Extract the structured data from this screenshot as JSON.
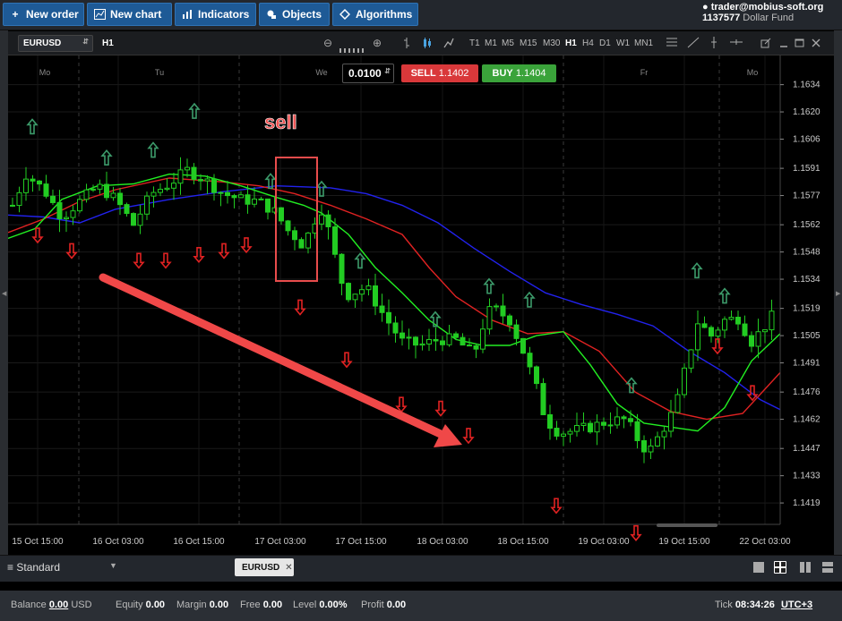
{
  "toolbar": {
    "new_order": "New order",
    "new_chart": "New chart",
    "indicators": "Indicators",
    "objects": "Objects",
    "algorithms": "Algorithms"
  },
  "account": {
    "user": "trader@mobius-soft.org",
    "number": "1137577",
    "fund": "Dollar Fund"
  },
  "chart_header": {
    "symbol": "EURUSD",
    "timeframe": "H1",
    "timeframes": [
      "T1",
      "M1",
      "M5",
      "M15",
      "M30",
      "H1",
      "H4",
      "D1",
      "W1",
      "MN1"
    ],
    "active_timeframe": "H1"
  },
  "order_panel": {
    "lot": "0.0100",
    "sell_label": "SELL",
    "sell_price": "1.1402",
    "buy_label": "BUY",
    "buy_price": "1.1404"
  },
  "annotation": {
    "text": "sell"
  },
  "chart_data": {
    "type": "candlestick",
    "symbol": "EURUSD",
    "timeframe": "H1",
    "y_ticks": [
      1.1634,
      1.162,
      1.1606,
      1.1591,
      1.1577,
      1.1562,
      1.1548,
      1.1534,
      1.1519,
      1.1505,
      1.1491,
      1.1476,
      1.1462,
      1.1447,
      1.1433,
      1.1419
    ],
    "ylim": [
      1.1408,
      1.1649
    ],
    "x_ticks": [
      "15 Oct 15:00",
      "16 Oct 03:00",
      "16 Oct 15:00",
      "17 Oct 03:00",
      "17 Oct 15:00",
      "18 Oct 03:00",
      "18 Oct 15:00",
      "19 Oct 03:00",
      "19 Oct 15:00",
      "22 Oct 03:00"
    ],
    "day_labels": [
      "Mo",
      "Tu",
      "We",
      "Fr",
      "Mo"
    ],
    "bull_color": "#22cc22",
    "bear_color": "#22cc22",
    "ma_fast_color": "#22ee22",
    "ma_mid_color": "#e02222",
    "ma_slow_color": "#2222ee",
    "up_arrow_color": "#3c9a6a",
    "down_arrow_color": "#e02222"
  },
  "bottom_tabs": {
    "profile": "Standard",
    "symbol_tab": "EURUSD"
  },
  "status": {
    "balance_label": "Balance",
    "balance": "0.00",
    "currency": "USD",
    "equity_label": "Equity",
    "equity": "0.00",
    "margin_label": "Margin",
    "margin": "0.00",
    "free_label": "Free",
    "free": "0.00",
    "level_label": "Level",
    "level": "0.00%",
    "profit_label": "Profit",
    "profit": "0.00",
    "tick_label": "Tick",
    "tick_time": "08:34:26",
    "timezone": "UTC+3"
  }
}
